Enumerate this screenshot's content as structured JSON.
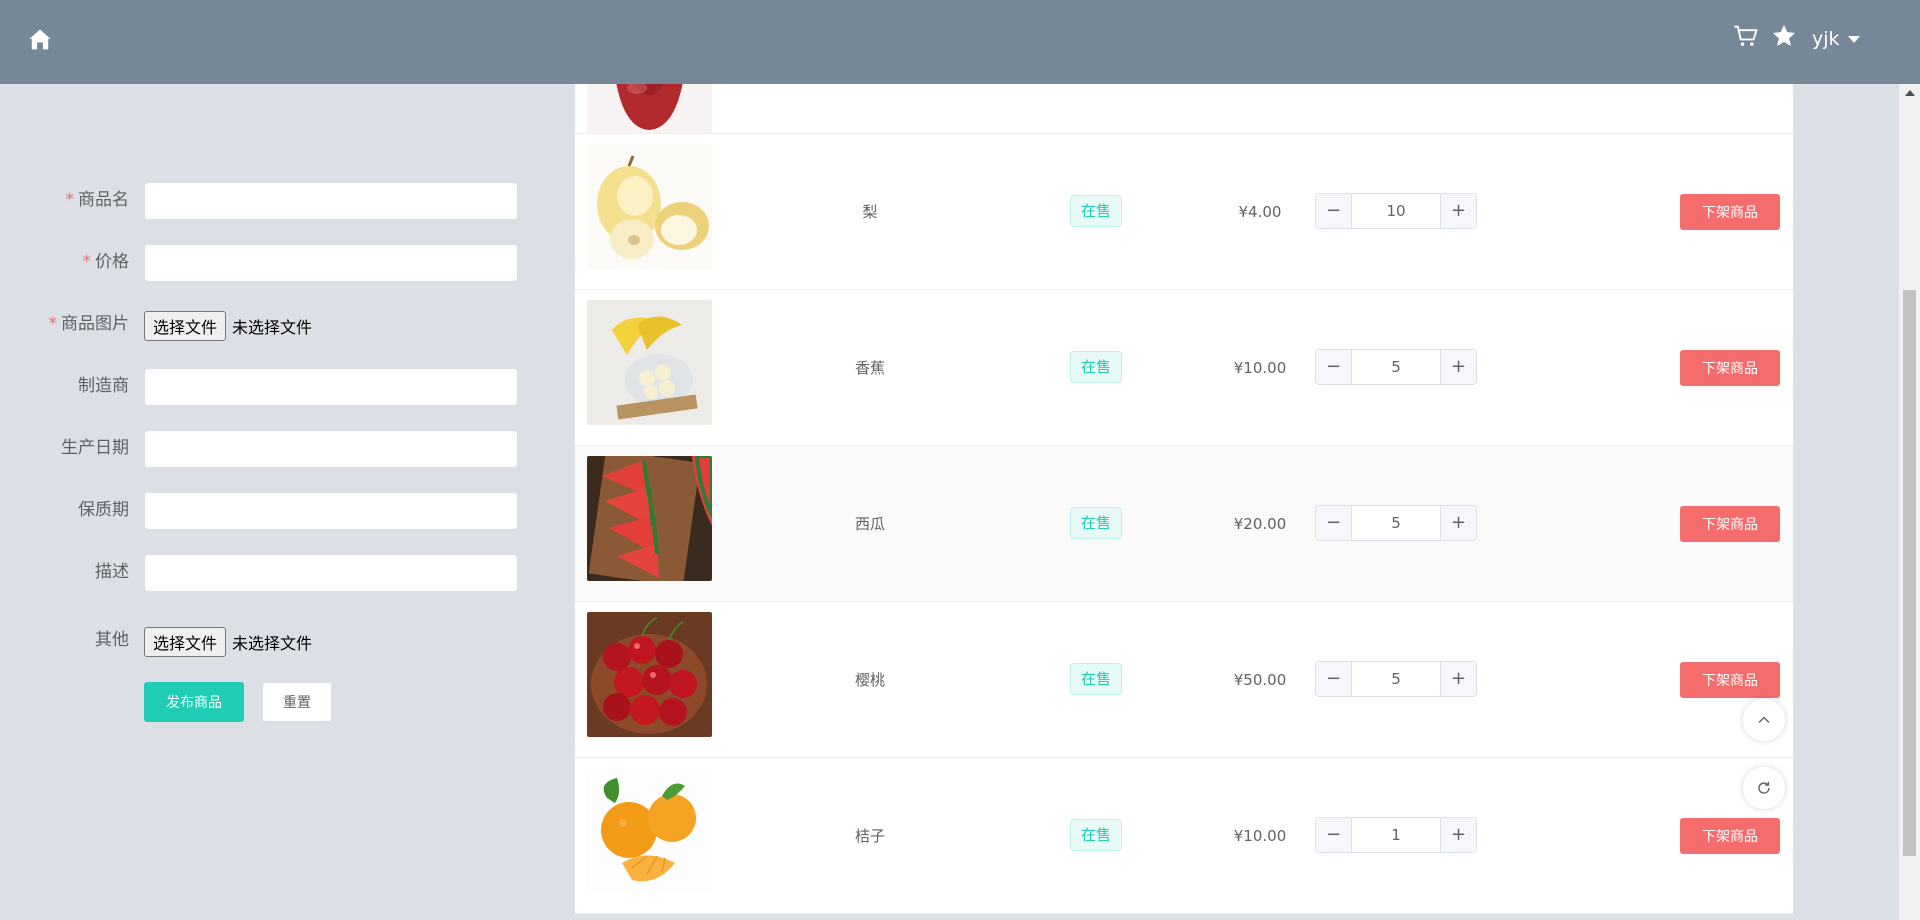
{
  "header": {
    "user_name": "yjk"
  },
  "form": {
    "fields": [
      {
        "label": "商品名",
        "required": true,
        "type": "text",
        "value": ""
      },
      {
        "label": "价格",
        "required": true,
        "type": "text",
        "value": ""
      },
      {
        "label": "商品图片",
        "required": true,
        "type": "file",
        "button": "选择文件",
        "status": "未选择文件"
      },
      {
        "label": "制造商",
        "required": false,
        "type": "text",
        "value": ""
      },
      {
        "label": "生产日期",
        "required": false,
        "type": "text",
        "value": ""
      },
      {
        "label": "保质期",
        "required": false,
        "type": "text",
        "value": ""
      },
      {
        "label": "描述",
        "required": false,
        "type": "text",
        "value": ""
      },
      {
        "label": "其他",
        "required": false,
        "type": "file",
        "button": "选择文件",
        "status": "未选择文件"
      }
    ],
    "required_mark": "*",
    "submit_label": "发布商品",
    "reset_label": "重置"
  },
  "products": [
    {
      "name": "梨",
      "status": "在售",
      "price": "¥4.00",
      "quantity": "10",
      "action": "下架商品",
      "image": "pear"
    },
    {
      "name": "香蕉",
      "status": "在售",
      "price": "¥10.00",
      "quantity": "5",
      "action": "下架商品",
      "image": "banana"
    },
    {
      "name": "西瓜",
      "status": "在售",
      "price": "¥20.00",
      "quantity": "5",
      "action": "下架商品",
      "image": "watermelon"
    },
    {
      "name": "樱桃",
      "status": "在售",
      "price": "¥50.00",
      "quantity": "5",
      "action": "下架商品",
      "image": "cherry"
    },
    {
      "name": "桔子",
      "status": "在售",
      "price": "¥10.00",
      "quantity": "1",
      "action": "下架商品",
      "image": "orange"
    }
  ],
  "stepper": {
    "minus": "−",
    "plus": "+"
  },
  "colors": {
    "header_bg": "#768898",
    "page_bg": "#dcdfe6",
    "primary": "#1ecdb4",
    "danger": "#f56c6c",
    "required": "#f56c6c"
  },
  "icons": {
    "home": "home-icon",
    "cart": "cart-icon",
    "favorites": "star-icon",
    "user_dropdown": "caret-down-icon",
    "back_to_top": "chevron-up-icon",
    "refresh": "refresh-icon"
  }
}
